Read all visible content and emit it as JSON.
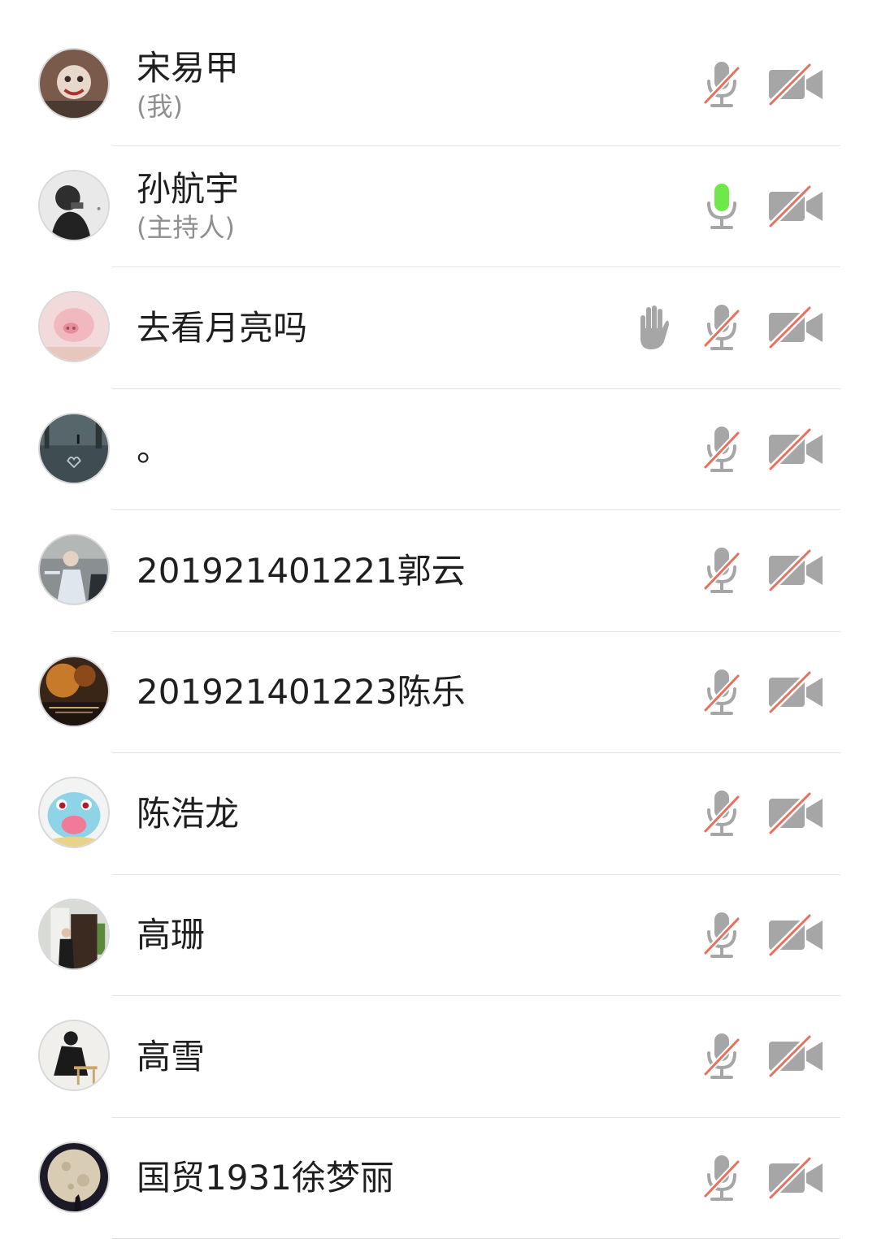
{
  "colors": {
    "icon_gray": "#a6a6a6",
    "muted_slash": "#e8705f",
    "speaking_green": "#6ee84a",
    "divider": "#e4e4e4"
  },
  "participants": [
    {
      "name": "宋易甲",
      "role": "(我)",
      "mic": "muted",
      "camera": "off",
      "hand_raised": false,
      "avatar_icon": "avatar-photo"
    },
    {
      "name": "孙航宇",
      "role": "(主持人)",
      "mic": "speaking",
      "camera": "off",
      "hand_raised": false,
      "avatar_icon": "avatar-photo"
    },
    {
      "name": "去看月亮吗",
      "role": "",
      "mic": "muted",
      "camera": "off",
      "hand_raised": true,
      "avatar_icon": "avatar-photo"
    },
    {
      "name": "。",
      "role": "",
      "mic": "muted",
      "camera": "off",
      "hand_raised": false,
      "avatar_icon": "avatar-photo"
    },
    {
      "name": "201921401221郭云",
      "role": "",
      "mic": "muted",
      "camera": "off",
      "hand_raised": false,
      "avatar_icon": "avatar-photo"
    },
    {
      "name": "201921401223陈乐",
      "role": "",
      "mic": "muted",
      "camera": "off",
      "hand_raised": false,
      "avatar_icon": "avatar-photo"
    },
    {
      "name": "陈浩龙",
      "role": "",
      "mic": "muted",
      "camera": "off",
      "hand_raised": false,
      "avatar_icon": "avatar-photo"
    },
    {
      "name": "高珊",
      "role": "",
      "mic": "muted",
      "camera": "off",
      "hand_raised": false,
      "avatar_icon": "avatar-photo"
    },
    {
      "name": "高雪",
      "role": "",
      "mic": "muted",
      "camera": "off",
      "hand_raised": false,
      "avatar_icon": "avatar-photo"
    },
    {
      "name": "国贸1931徐梦丽",
      "role": "",
      "mic": "muted",
      "camera": "off",
      "hand_raised": false,
      "avatar_icon": "avatar-photo"
    }
  ]
}
